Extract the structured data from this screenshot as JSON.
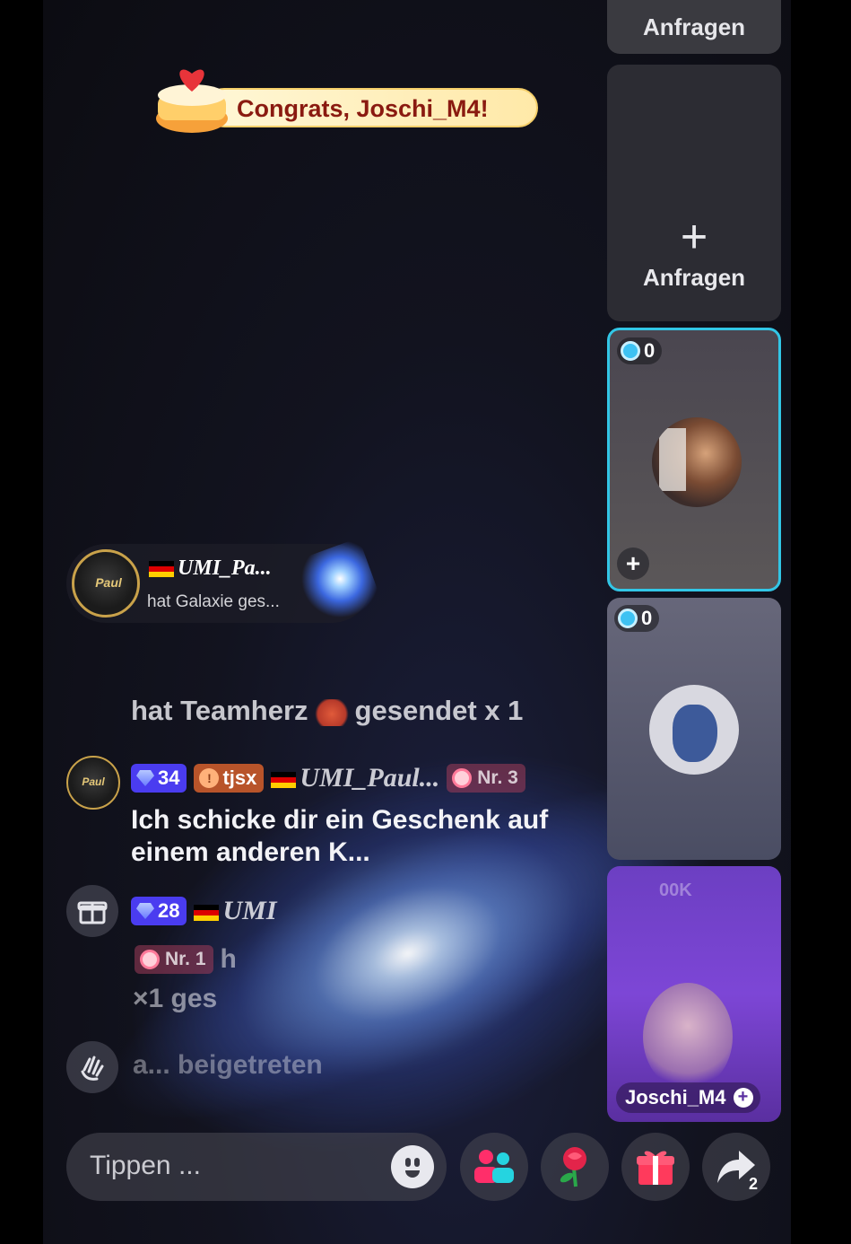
{
  "banner": {
    "text": "Congrats, Joschi_M4!"
  },
  "right_panel": {
    "top_button_label": "Anfragen",
    "request_card": {
      "plus": "+",
      "label": "Anfragen"
    },
    "guests": [
      {
        "score": "0",
        "add": "+"
      },
      {
        "score": "0"
      },
      {
        "name": "Joschi_M4",
        "plus": "+",
        "faded_value": "00K"
      }
    ]
  },
  "gift_notification": {
    "avatar_text": "Paul",
    "name": "UMI_Pa...",
    "subtitle": "hat Galaxie  ges..."
  },
  "chat": {
    "line1_left": "hat Teamherz",
    "line1_right": "gesendet x 1",
    "message1": {
      "avatar_text": "Paul",
      "level": "34",
      "fan_name": "tjsx",
      "fan_icon": "!",
      "name": "UMI_Paul...",
      "rank": "Nr. 3",
      "text": "Ich schicke dir ein Geschenk auf einem anderen K..."
    },
    "message2": {
      "level": "28",
      "name": "UMI",
      "rank": "Nr. 1",
      "text_partial": "h",
      "text2": "×1 ges"
    },
    "joined": {
      "text": "a...      beigetreten"
    }
  },
  "bottom_bar": {
    "input_placeholder": "Tippen ...",
    "share_count": "2"
  },
  "colors": {
    "accent_cyan": "#32c6e6",
    "level_badge": "#4a3cf0",
    "fan_badge": "#b8542a",
    "banner_text": "#8a1a10"
  }
}
